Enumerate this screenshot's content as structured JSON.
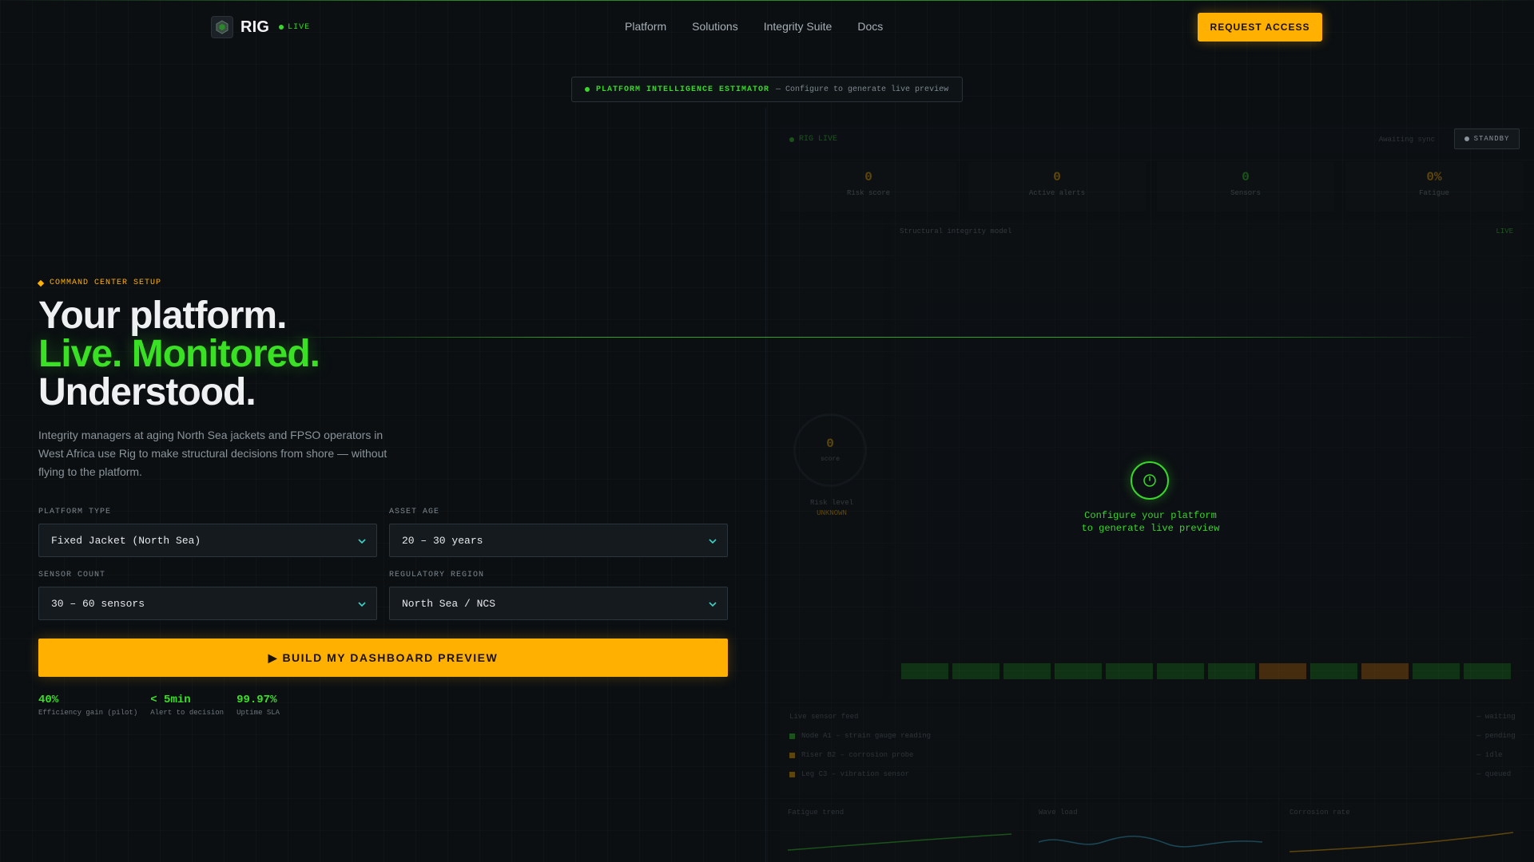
{
  "nav": {
    "brand": "RIG",
    "live_label": "LIVE",
    "links": [
      "Platform",
      "Solutions",
      "Integrity Suite",
      "Docs"
    ],
    "cta": "REQUEST ACCESS"
  },
  "estimator": {
    "label": "PLATFORM INTELLIGENCE ESTIMATOR",
    "sub": "— Configure to generate live preview"
  },
  "hero": {
    "eyebrow": "COMMAND CENTER SETUP",
    "line1": "Your platform.",
    "line2": "Live. Monitored.",
    "line3": "Understood.",
    "description": "Integrity managers at aging North Sea jackets and FPSO operators in West Africa use Rig to make structural decisions from shore — without flying to the platform."
  },
  "form": {
    "platform_type": {
      "label": "PLATFORM TYPE",
      "value": "Fixed Jacket (North Sea)"
    },
    "asset_age": {
      "label": "ASSET AGE",
      "value": "20 – 30 years"
    },
    "sensor_count": {
      "label": "SENSOR COUNT",
      "value": "30 – 60 sensors"
    },
    "regulatory_region": {
      "label": "REGULATORY REGION",
      "value": "North Sea / NCS"
    },
    "submit": "▶ BUILD MY DASHBOARD PREVIEW"
  },
  "stats": [
    {
      "value": "40%",
      "label": "Efficiency gain (pilot)"
    },
    {
      "value": "< 5min",
      "label": "Alert to decision"
    },
    {
      "value": "99.97%",
      "label": "Uptime SLA"
    }
  ],
  "preview": {
    "standby": "STANDBY",
    "overlay_line1": "Configure your platform",
    "overlay_line2": "to generate live preview",
    "head_live": "RIG LIVE",
    "head_sync": "Awaiting sync",
    "kpis": [
      {
        "value": "0",
        "label": "Risk score",
        "color": "#ffb000"
      },
      {
        "value": "0",
        "label": "Active alerts",
        "color": "#ffb000"
      },
      {
        "value": "0",
        "label": "Sensors",
        "color": "#39d62b"
      },
      {
        "value": "0%",
        "label": "Fatigue",
        "color": "#ffb000"
      }
    ],
    "gauge_value": "0",
    "gauge_label": "score",
    "side_caption1": "Risk level",
    "side_caption2": "UNKNOWN",
    "main_title": "Structural integrity model",
    "main_tag": "LIVE",
    "strip_colors": [
      "#1f7a1b",
      "#1f7a1b",
      "#1f7a1b",
      "#1f7a1b",
      "#1f7a1b",
      "#1f7a1b",
      "#1f7a1b",
      "#b5650a",
      "#1f7a1b",
      "#b5650a",
      "#1f7a1b",
      "#1f7a1b"
    ],
    "list_title": "Live sensor feed",
    "list_tag": "— waiting",
    "list_rows": [
      {
        "text": "Node A1 – strain gauge reading",
        "value": "— pending",
        "color": "#39d62b"
      },
      {
        "text": "Riser B2 – corrosion probe",
        "value": "— idle",
        "color": "#ffb000"
      },
      {
        "text": "Leg C3 – vibration sensor",
        "value": "— queued",
        "color": "#ffb000"
      }
    ],
    "bottom_titles": [
      "Fatigue trend",
      "Wave load",
      "Corrosion rate"
    ]
  }
}
